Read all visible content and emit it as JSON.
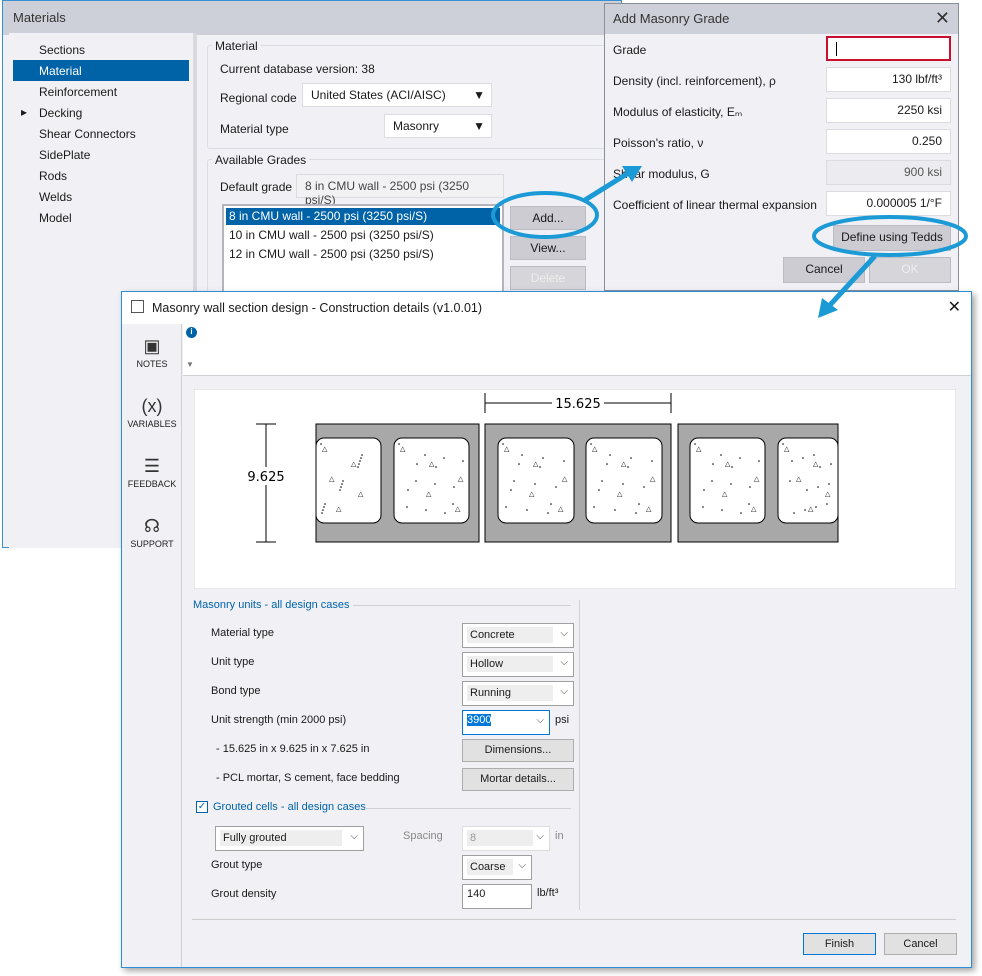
{
  "materials_window": {
    "title": "Materials",
    "sidebar": [
      "Sections",
      "Material",
      "Reinforcement",
      "Decking",
      "Shear Connectors",
      "SidePlate",
      "Rods",
      "Welds",
      "Model"
    ],
    "material_group": "Material",
    "db_version": "Current database version: 38",
    "regional_code_label": "Regional code",
    "regional_code": "United States (ACI/AISC)",
    "material_type_label": "Material type",
    "material_type": "Masonry",
    "grades_group": "Available Grades",
    "default_grade_label": "Default grade",
    "default_grade": "8 in CMU wall - 2500 psi (3250 psi/S)",
    "grades": [
      "8 in CMU wall - 2500 psi (3250 psi/S)",
      "10 in CMU wall - 2500 psi (3250 psi/S)",
      "12 in CMU wall - 2500 psi (3250 psi/S)"
    ],
    "add": "Add...",
    "view": "View...",
    "delete": "Delete"
  },
  "grade_dialog": {
    "title": "Add Masonry Grade",
    "rows": [
      {
        "label": "Grade",
        "value": ""
      },
      {
        "label": "Density (incl. reinforcement), ρ",
        "value": "130 lbf/ft³"
      },
      {
        "label": "Modulus of elasticity, Eₘ",
        "value": "2250 ksi"
      },
      {
        "label": "Poisson's ratio, ν",
        "value": "0.250"
      },
      {
        "label": "Shear modulus, G",
        "value": "900 ksi"
      },
      {
        "label": "Coefficient of linear thermal expansion",
        "value": "0.000005 1/°F"
      }
    ],
    "define": "Define using Tedds",
    "cancel": "Cancel",
    "ok": "OK"
  },
  "tedds": {
    "title": "Masonry wall section design - Construction details (v1.0.01)",
    "nav": [
      "NOTES",
      "VARIABLES",
      "FEEDBACK",
      "SUPPORT"
    ],
    "dim_width": "15.625",
    "dim_height": "9.625",
    "units_group": "Masonry units - all design cases",
    "material_type_label": "Material type",
    "material_type": "Concrete",
    "unit_type_label": "Unit type",
    "unit_type": "Hollow",
    "bond_type_label": "Bond type",
    "bond_type": "Running",
    "strength_label": "Unit strength (min 2000 psi)",
    "strength": "3900",
    "strength_unit": "psi",
    "dims_text": "- 15.625 in x 9.625 in x 7.625 in",
    "dims_button": "Dimensions...",
    "mortar_text": "- PCL mortar, S cement, face bedding",
    "mortar_button": "Mortar details...",
    "grouted_group": "Grouted cells - all design cases",
    "grouted_checked": true,
    "grouting": "Fully grouted",
    "spacing_label": "Spacing",
    "spacing": "8",
    "spacing_unit": "in",
    "grout_type_label": "Grout type",
    "grout_type": "Coarse",
    "grout_density_label": "Grout density",
    "grout_density": "140",
    "grout_density_unit": "lb/ft³",
    "finish": "Finish",
    "cancel": "Cancel"
  },
  "colors": {
    "accent": "#0063a8",
    "callout": "#1b9ad6"
  }
}
